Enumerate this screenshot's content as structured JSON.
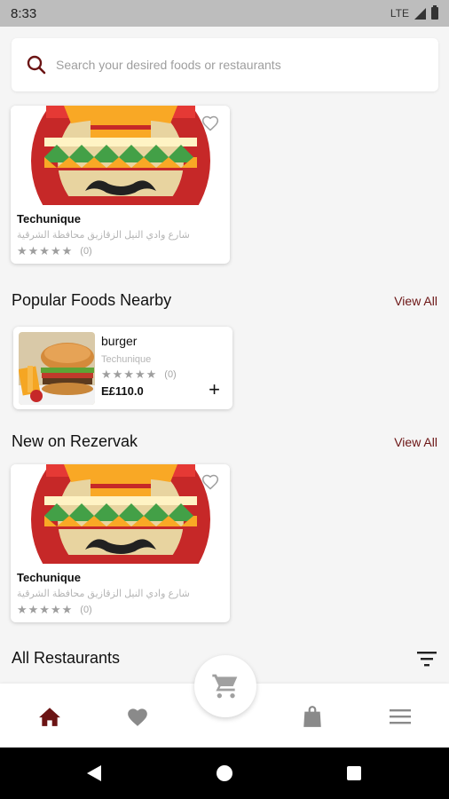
{
  "status_bar": {
    "time": "8:33",
    "network": "LTE"
  },
  "search": {
    "placeholder": "Search your desired foods or restaurants"
  },
  "restaurant_card_top": {
    "name": "Techunique",
    "address": "شارع وادي النيل الزقازيق محافظة الشرقية",
    "stars": "★★★★★",
    "rating_count": "(0)"
  },
  "popular": {
    "title": "Popular Foods Nearby",
    "view_all": "View All",
    "items": [
      {
        "name": "burger",
        "restaurant": "Techunique",
        "stars": "★★★★★",
        "rating_count": "(0)",
        "price": "E£110.0",
        "add": "+"
      }
    ]
  },
  "new_on": {
    "title": "New on Rezervak",
    "view_all": "View All",
    "card": {
      "name": "Techunique",
      "address": "شارع وادي النيل الزقازيق محافظة الشرقية",
      "stars": "★★★★★",
      "rating_count": "(0)"
    }
  },
  "all_restaurants": {
    "title": "All Restaurants"
  },
  "bottom_nav": {
    "items": [
      "home-icon",
      "heart-icon",
      "cart-icon",
      "bag-icon",
      "menu-icon"
    ],
    "active": "home-icon"
  },
  "colors": {
    "accent": "#6b1414",
    "inactive_icon": "#8a8a8a",
    "background": "#f5f5f5"
  }
}
